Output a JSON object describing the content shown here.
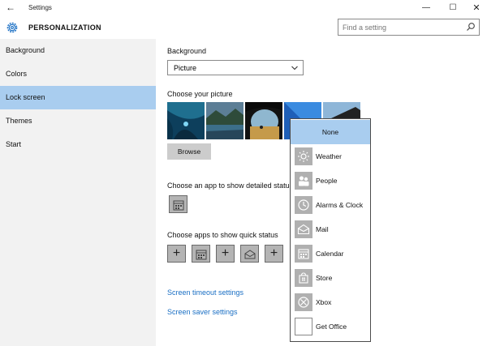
{
  "window": {
    "title": "Settings"
  },
  "header": {
    "title": "PERSONALIZATION",
    "search_placeholder": "Find a setting"
  },
  "sidebar": {
    "items": [
      {
        "label": "Background"
      },
      {
        "label": "Colors"
      },
      {
        "label": "Lock screen",
        "active": true
      },
      {
        "label": "Themes"
      },
      {
        "label": "Start"
      }
    ]
  },
  "main": {
    "background_label": "Background",
    "background_value": "Picture",
    "choose_picture_label": "Choose your picture",
    "browse_label": "Browse",
    "detailed_status_label": "Choose an app to show detailed status",
    "quick_status_label": "Choose apps to show quick status",
    "timeout_link": "Screen timeout settings",
    "saver_link": "Screen saver settings"
  },
  "dropdown": {
    "items": [
      {
        "label": "None",
        "icon": "none",
        "selected": true
      },
      {
        "label": "Weather",
        "icon": "weather-icon"
      },
      {
        "label": "People",
        "icon": "people-icon"
      },
      {
        "label": "Alarms & Clock",
        "icon": "clock-icon"
      },
      {
        "label": "Mail",
        "icon": "mail-icon"
      },
      {
        "label": "Calendar",
        "icon": "calendar-icon"
      },
      {
        "label": "Store",
        "icon": "store-icon"
      },
      {
        "label": "Xbox",
        "icon": "xbox-icon"
      },
      {
        "label": "Get Office",
        "icon": "office-icon"
      }
    ]
  },
  "colors": {
    "accent": "#a9cdef",
    "link": "#1a6fc4",
    "sidebar_bg": "#f2f2f2"
  }
}
